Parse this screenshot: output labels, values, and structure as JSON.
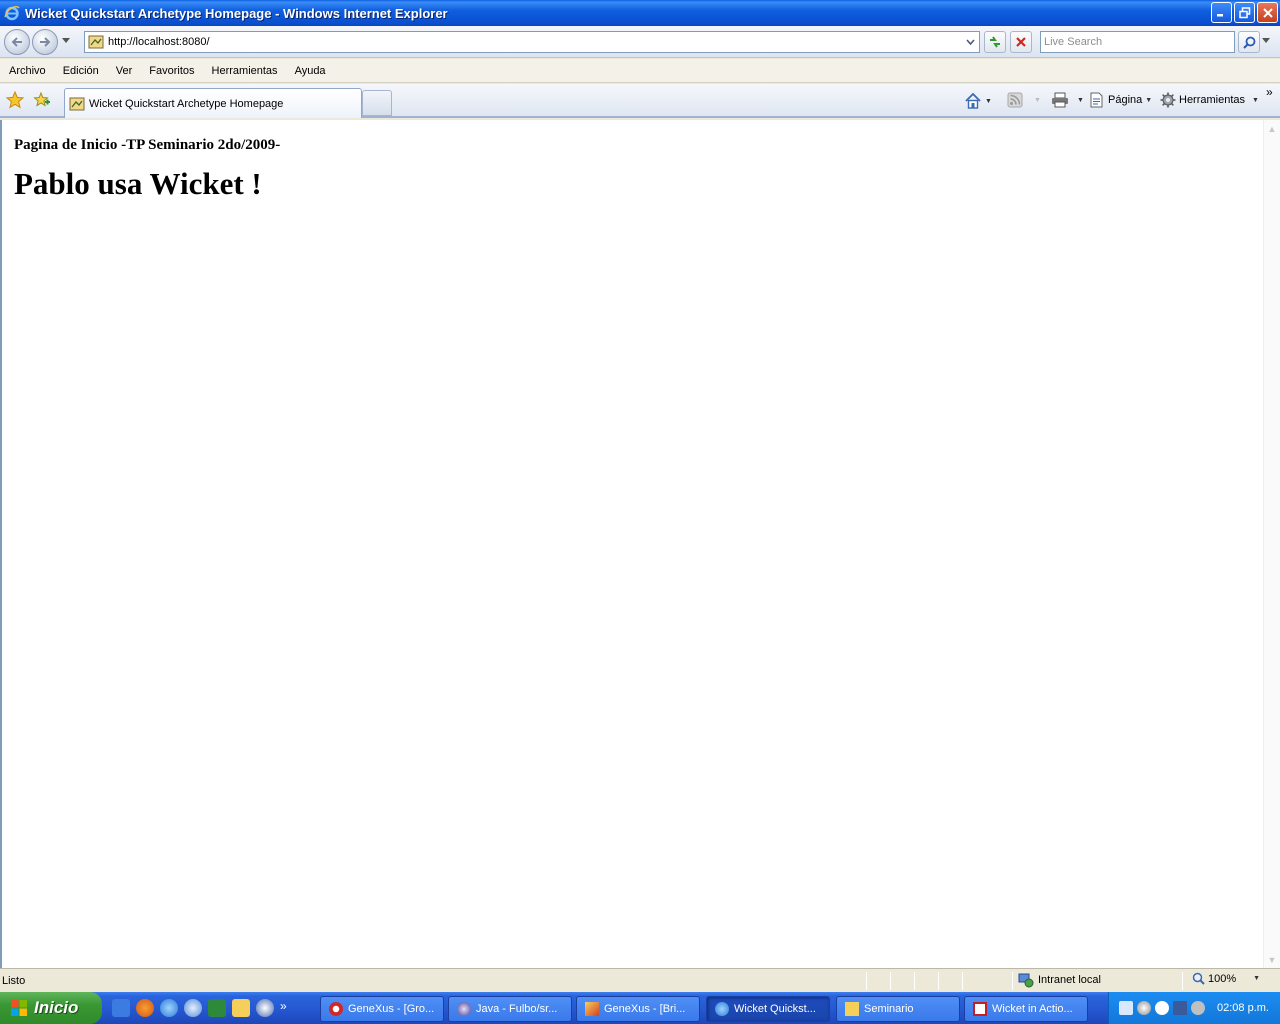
{
  "window": {
    "title": "Wicket Quickstart Archetype Homepage - Windows Internet Explorer"
  },
  "navigation": {
    "url": "http://localhost:8080/",
    "search_placeholder": "Live Search"
  },
  "menu": [
    "Archivo",
    "Edición",
    "Ver",
    "Favoritos",
    "Herramientas",
    "Ayuda"
  ],
  "tabs": {
    "active_label": "Wicket Quickstart Archetype Homepage"
  },
  "command_bar": {
    "page_label": "Página",
    "tools_label": "Herramientas"
  },
  "page": {
    "subtitle": "Pagina de Inicio -TP Seminario 2do/2009-",
    "heading": "Pablo usa Wicket !"
  },
  "status": {
    "text": "Listo",
    "zone": "Intranet local",
    "zoom": "100%"
  },
  "taskbar": {
    "start_label": "Inicio",
    "tasks": [
      {
        "label": "GeneXus - [Gro...",
        "icon": "genexus-icon"
      },
      {
        "label": "Java - Fulbo/sr...",
        "icon": "eclipse-icon"
      },
      {
        "label": "GeneXus - [Bri...",
        "icon": "genexus-window-icon"
      },
      {
        "label": "Wicket Quickst...",
        "icon": "ie-icon"
      },
      {
        "label": "Seminario",
        "icon": "folder-icon"
      },
      {
        "label": "Wicket in Actio...",
        "icon": "pdf-icon"
      }
    ],
    "clock": "02:08 p.m."
  }
}
